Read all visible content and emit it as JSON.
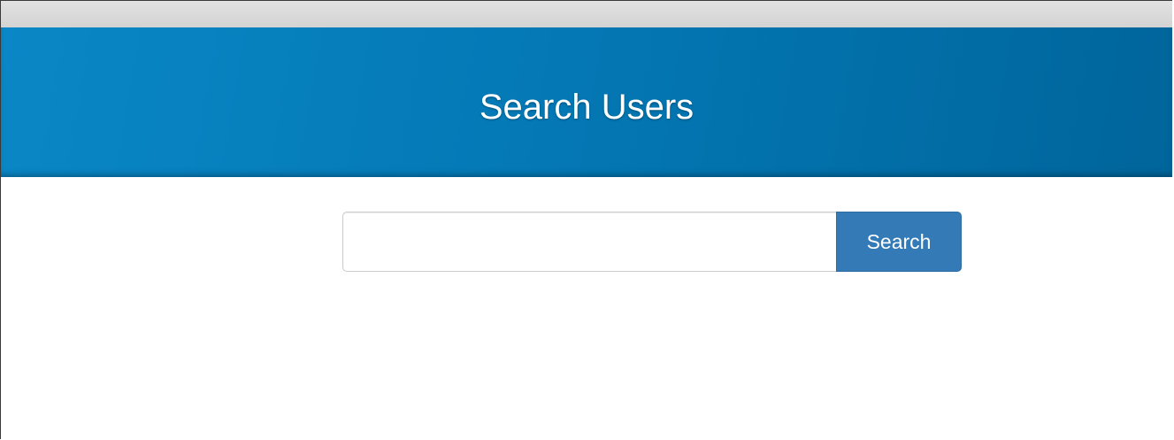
{
  "header": {
    "title": "Search Users"
  },
  "search": {
    "value": "",
    "placeholder": "",
    "button_label": "Search"
  },
  "colors": {
    "banner": "#0479b6",
    "button": "#337ab7"
  }
}
